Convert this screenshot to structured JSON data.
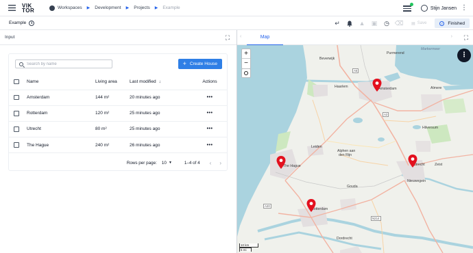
{
  "topbar": {
    "logo_line1": "VIK",
    "logo_line2": "TOR",
    "breadcrumbs": [
      "Workspaces",
      "Development",
      "Projects",
      "Example"
    ],
    "user_name": "Stijn Jansen"
  },
  "subbar": {
    "app_name": "Example",
    "save_label": "Save",
    "status_label": "Finished"
  },
  "left_panel": {
    "title": "Input",
    "search_placeholder": "Search by name",
    "create_button": "Create House",
    "columns": [
      "Name",
      "Living area",
      "Last modified",
      "Actions"
    ],
    "rows": [
      {
        "name": "Amsterdam",
        "area": "144 m²",
        "modified": "20 minutes ago"
      },
      {
        "name": "Rotterdam",
        "area": "120 m²",
        "modified": "25 minutes ago"
      },
      {
        "name": "Utrecht",
        "area": "80 m²",
        "modified": "25 minutes ago"
      },
      {
        "name": "The Hague",
        "area": "240 m²",
        "modified": "26 minutes ago"
      }
    ],
    "rows_per_page_label": "Rows per page:",
    "rows_per_page_value": "10",
    "range_label": "1–4 of 4"
  },
  "right_panel": {
    "tab_label": "Map",
    "places": {
      "purmerend": "Purmerend",
      "beverwijk": "Beverwijk",
      "markermeer": "Markermeer",
      "haarlem": "Haarlem",
      "amsterdam": "Amsterdam",
      "almere": "Almere",
      "hilversum": "Hilversum",
      "leiden": "Leiden",
      "alphen1": "Alphen aan",
      "alphen2": "den Rijn",
      "thehague": "The Hague",
      "utrecht": "Utrecht",
      "zeist": "Zeist",
      "nieuwegein": "Nieuwegein",
      "gouda": "Gouda",
      "rotterdam": "Rotterdam",
      "dordrecht": "Dordrecht",
      "a5": "A5",
      "a2": "A2",
      "a20": "A20",
      "n214": "N214"
    },
    "scale_km": "10 km",
    "scale_mi": "5 mi",
    "markers": [
      {
        "name": "Amsterdam"
      },
      {
        "name": "The Hague"
      },
      {
        "name": "Utrecht"
      },
      {
        "name": "Rotterdam"
      }
    ]
  },
  "colors": {
    "accent": "#2f7fe6",
    "marker": "#e3101e",
    "water": "#aad3df",
    "status_bg": "#e6eef8"
  },
  "icons": {
    "menu": "hamburger-icon",
    "workspace": "workspace-icon",
    "notification": "bell-icon",
    "history": "history-icon",
    "status": "check-circle-icon",
    "expand": "expand-icon",
    "locate": "locate-icon"
  }
}
